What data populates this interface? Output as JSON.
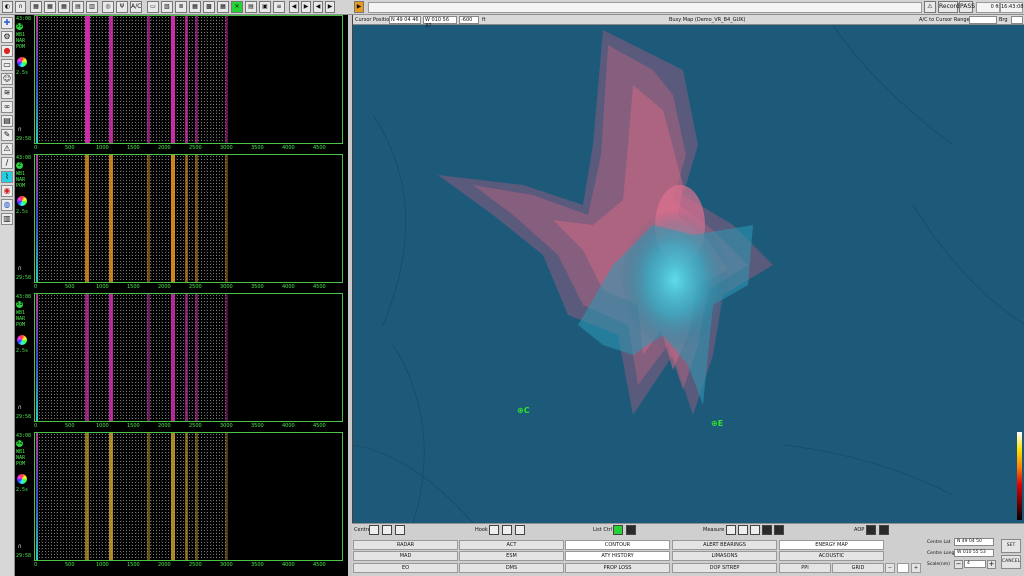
{
  "toolbar": {
    "atc_label": "A/C",
    "record_label": "Record",
    "pass_label": "PASS",
    "depth_value": "0 ft",
    "clock": "16:43:08"
  },
  "waterfalls": [
    {
      "time_top": "43:08",
      "channel": "53",
      "line1": "WB1",
      "line2": "NAR",
      "line3": "POM",
      "scale": "2.5s",
      "time_bottom": "29:58",
      "accent": "#e02fb8"
    },
    {
      "time_top": "43:08",
      "channel": "2",
      "line1": "WB1",
      "line2": "NAR",
      "line3": "POM",
      "scale": "2.5s",
      "time_bottom": "29:58",
      "accent": "#e0941f"
    },
    {
      "time_top": "43:08",
      "channel": "53",
      "line1": "WB1",
      "line2": "NAR",
      "line3": "POM",
      "scale": "2.5s",
      "time_bottom": "29:58",
      "accent": "#d22fb0"
    },
    {
      "time_top": "43:08",
      "channel": "52",
      "line1": "WB1",
      "line2": "NAR",
      "line3": "POM",
      "scale": "2.5s",
      "time_bottom": "29:58",
      "accent": "#c8a02a"
    }
  ],
  "freq_ticks": [
    "0",
    "500",
    "1000",
    "1500",
    "2000",
    "2500",
    "3000",
    "3500",
    "4000",
    "4500"
  ],
  "map": {
    "cursor_label": "Cursor Position:",
    "cursor_lat": "N 49 04 46",
    "cursor_lon": "W 010 56 37",
    "cursor_depth": "-600",
    "depth_unit": "ft",
    "title": "Busy Map (Demo_VR_B4_GUK)",
    "range_label": "A/C to Cursor Range:",
    "brg_label": "Brg",
    "marker_a": "C",
    "marker_b": "E"
  },
  "bottom": {
    "centre_label": "Centre",
    "hook_label": "Hook",
    "listctrl_label": "List Ctrl",
    "measure_label": "Measure",
    "aop_label": "AOP",
    "buttons_row1": [
      "RADAR",
      "ACT",
      "CONTOUR",
      "ALERT BEARINGS",
      "ENERGY MAP"
    ],
    "buttons_row2": [
      "MAD",
      "ESM",
      "ATY HISTORY",
      "LIMASONS",
      "ACOUSTIC"
    ],
    "buttons_row3": [
      "EO",
      "DMS",
      "PROP LOSS",
      "DOP SITREP",
      "PPI",
      "GRID"
    ]
  },
  "centre": {
    "lat_label": "Centre Lat",
    "lat_value": "N 49 04 50",
    "lon_label": "Centre Long",
    "lon_value": "W 010 55 53",
    "scale_label": "Scale(nm)",
    "scale_value": "4",
    "set_label": "SET",
    "cancel_label": "CANCEL",
    "minus": "−",
    "plus": "+"
  },
  "colors": {
    "map_bg": "#1d5a7a",
    "contour_red": "#c96a84",
    "contour_cyan": "#32c5d8",
    "marker": "#2fe12f",
    "active_tool": "#25d0e3"
  }
}
